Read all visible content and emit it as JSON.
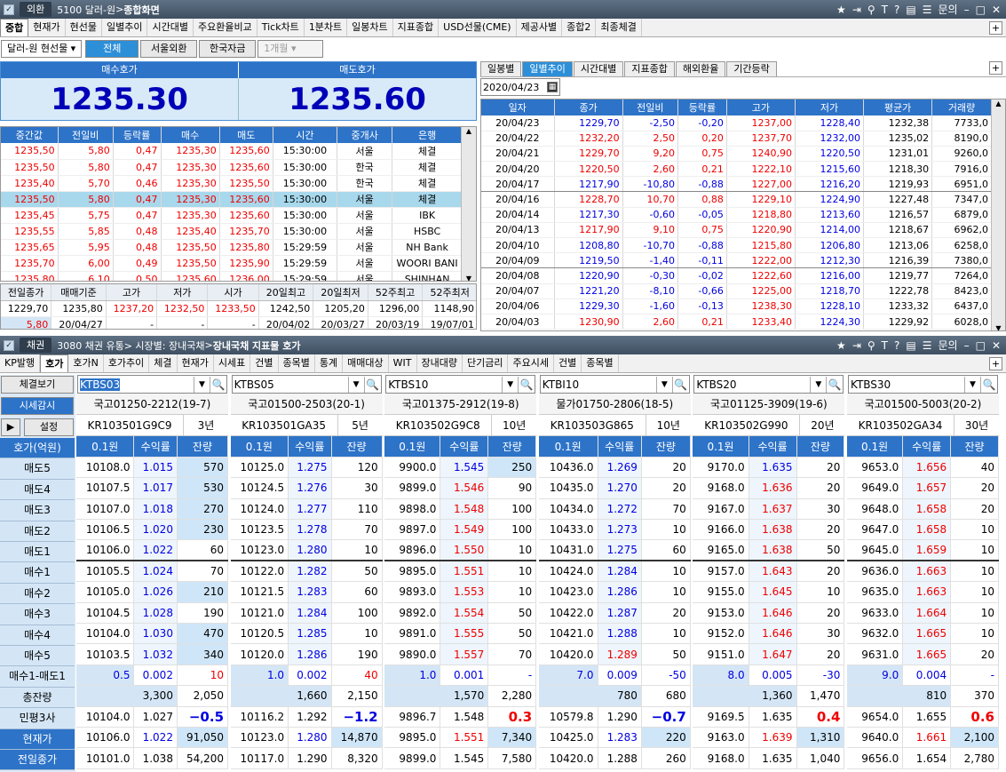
{
  "top_title": {
    "tag": "외환",
    "code": "5100 달러-원",
    "name": "종합화면",
    "right_label": "문의"
  },
  "top_menu": [
    "중합",
    "현재가",
    "현선물",
    "일별추이",
    "시간대별",
    "주요환율비교",
    "Tick차트",
    "1분차트",
    "일봉차트",
    "지표종합",
    "USD선물(CME)",
    "제공사별",
    "종합2",
    "최종체결"
  ],
  "top_menu_selected": 0,
  "filter": {
    "product": "달러-원 현선물",
    "tabs": [
      "전체",
      "서울외환",
      "한국자금"
    ],
    "period": "1개월"
  },
  "bid_label": "매수호가",
  "ask_label": "매도호가",
  "bid": "1235.30",
  "ask": "1235.60",
  "tick_headers": [
    "중간값",
    "전일비",
    "등락률",
    "매수",
    "매도",
    "시간",
    "중개사",
    "은행"
  ],
  "ticks": [
    [
      "1235,50",
      "5,80",
      "0,47",
      "1235,30",
      "1235,60",
      "15:30:00",
      "서울",
      "체결"
    ],
    [
      "1235,50",
      "5,80",
      "0,47",
      "1235,30",
      "1235,60",
      "15:30:00",
      "한국",
      "체결"
    ],
    [
      "1235,40",
      "5,70",
      "0,46",
      "1235,30",
      "1235,50",
      "15:30:00",
      "한국",
      "체결"
    ],
    [
      "1235,50",
      "5,80",
      "0,47",
      "1235,30",
      "1235,60",
      "15:30:00",
      "서울",
      "체결"
    ],
    [
      "1235,45",
      "5,75",
      "0,47",
      "1235,30",
      "1235,60",
      "15:30:00",
      "서울",
      "IBK"
    ],
    [
      "1235,55",
      "5,85",
      "0,48",
      "1235,40",
      "1235,70",
      "15:30:00",
      "서울",
      "HSBC"
    ],
    [
      "1235,65",
      "5,95",
      "0,48",
      "1235,50",
      "1235,80",
      "15:29:59",
      "서울",
      "NH Bank"
    ],
    [
      "1235,70",
      "6,00",
      "0,49",
      "1235,50",
      "1235,90",
      "15:29:59",
      "서울",
      "WOORI BANI"
    ],
    [
      "1235,80",
      "6,10",
      "0,50",
      "1235,60",
      "1236,00",
      "15:29:59",
      "서울",
      "SHINHAN"
    ]
  ],
  "tick_selected": 3,
  "summary_headers": [
    "전일종가",
    "매매기준",
    "고가",
    "저가",
    "시가",
    "20일최고",
    "20일최저",
    "52주최고",
    "52주최저"
  ],
  "summary_row1": [
    "1229,70",
    "1235,80",
    "1237,20",
    "1232,50",
    "1233,50",
    "1242,50",
    "1205,20",
    "1296,00",
    "1148,90"
  ],
  "summary_row2": [
    "5,80",
    "20/04/27",
    "-",
    "-",
    "-",
    "20/04/02",
    "20/03/27",
    "20/03/19",
    "19/07/01"
  ],
  "right_tabs": [
    "일봉별",
    "일별추이",
    "시간대별",
    "지표종합",
    "해외환율",
    "기간등락"
  ],
  "right_tab_selected": 1,
  "date_value": "2020/04/23",
  "daily_headers": [
    "일자",
    "종가",
    "전일비",
    "등락률",
    "고가",
    "저가",
    "평균가",
    "거래량"
  ],
  "daily": [
    [
      "20/04/23",
      "1229,70",
      "-2,50",
      "-0,20",
      "1237,00",
      "1228,40",
      "1232,38",
      "7733,0"
    ],
    [
      "20/04/22",
      "1232,20",
      "2,50",
      "0,20",
      "1237,70",
      "1232,00",
      "1235,02",
      "8190,0"
    ],
    [
      "20/04/21",
      "1229,70",
      "9,20",
      "0,75",
      "1240,90",
      "1220,50",
      "1231,01",
      "9260,0"
    ],
    [
      "20/04/20",
      "1220,50",
      "2,60",
      "0,21",
      "1222,10",
      "1215,60",
      "1218,30",
      "7916,0"
    ],
    [
      "20/04/17",
      "1217,90",
      "-10,80",
      "-0,88",
      "1227,00",
      "1216,20",
      "1219,93",
      "6951,0"
    ],
    [
      "20/04/16",
      "1228,70",
      "10,70",
      "0,88",
      "1229,10",
      "1224,90",
      "1227,48",
      "7347,0"
    ],
    [
      "20/04/14",
      "1217,30",
      "-0,60",
      "-0,05",
      "1218,80",
      "1213,60",
      "1216,57",
      "6879,0"
    ],
    [
      "20/04/13",
      "1217,90",
      "9,10",
      "0,75",
      "1220,90",
      "1214,00",
      "1218,67",
      "6962,0"
    ],
    [
      "20/04/10",
      "1208,80",
      "-10,70",
      "-0,88",
      "1215,80",
      "1206,80",
      "1213,06",
      "6258,0"
    ],
    [
      "20/04/09",
      "1219,50",
      "-1,40",
      "-0,11",
      "1222,00",
      "1212,30",
      "1216,39",
      "7380,0"
    ],
    [
      "20/04/08",
      "1220,90",
      "-0,30",
      "-0,02",
      "1222,60",
      "1216,00",
      "1219,77",
      "7264,0"
    ],
    [
      "20/04/07",
      "1221,20",
      "-8,10",
      "-0,66",
      "1225,00",
      "1218,70",
      "1222,78",
      "8423,0"
    ],
    [
      "20/04/06",
      "1229,30",
      "-1,60",
      "-0,13",
      "1238,30",
      "1228,10",
      "1233,32",
      "6437,0"
    ],
    [
      "20/04/03",
      "1230,90",
      "2,60",
      "0,21",
      "1233,40",
      "1224,30",
      "1229,92",
      "6028,0"
    ]
  ],
  "bot_title": {
    "tag": "채권",
    "code": "3080 채권 유통> 시장별: 장내국채",
    "name": "장내국채 지표물 호가",
    "right_label": "문의"
  },
  "bot_menu": [
    "KP발행",
    "호가",
    "호가N",
    "호가추이",
    "체결",
    "현재가",
    "시세표",
    "건별",
    "종목별",
    "통계",
    "매매대상",
    "WIT",
    "장내대량",
    "단기금리",
    "주요시세",
    "건별",
    "종목별"
  ],
  "bot_menu_selected": 1,
  "left_labels": {
    "btn1": "체결보기",
    "btn2": "시세감시",
    "btn3": "설정",
    "hdr": "호가(억원)",
    "rows": [
      "매도5",
      "매도4",
      "매도3",
      "매도2",
      "매도1",
      "매수1",
      "매수2",
      "매수3",
      "매수4",
      "매수5",
      "매수1-매도1",
      "총잔량",
      "민평3사",
      "현재가",
      "전일종가"
    ]
  },
  "bond_col_headers": [
    "0.1원",
    "수익률",
    "잔량"
  ],
  "bonds": [
    {
      "code": "KTBS03",
      "name": "국고01250-2212(19-7)",
      "isin": "KR103501G9C9",
      "term": "3년",
      "rows": [
        [
          "10108.0",
          "1.015",
          "570"
        ],
        [
          "10107.5",
          "1.017",
          "530"
        ],
        [
          "10107.0",
          "1.018",
          "270"
        ],
        [
          "10106.5",
          "1.020",
          "230"
        ],
        [
          "10106.0",
          "1.022",
          "60"
        ],
        [
          "10105.5",
          "1.024",
          "70"
        ],
        [
          "10105.0",
          "1.026",
          "210"
        ],
        [
          "10104.5",
          "1.028",
          "190"
        ],
        [
          "10104.0",
          "1.030",
          "470"
        ],
        [
          "10103.5",
          "1.032",
          "340"
        ]
      ],
      "diff": [
        "0.5",
        "0.002",
        "10"
      ],
      "total": [
        "3,300",
        "2,050"
      ],
      "minpyeong": [
        "10104.0",
        "1.027",
        "−0.5"
      ],
      "current": [
        "10106.0",
        "1.022",
        "91,050"
      ],
      "prev": [
        "10101.0",
        "1.038",
        "54,200"
      ]
    },
    {
      "code": "KTBS05",
      "name": "국고01500-2503(20-1)",
      "isin": "KR103501GA35",
      "term": "5년",
      "rows": [
        [
          "10125.0",
          "1.275",
          "120"
        ],
        [
          "10124.5",
          "1.276",
          "30"
        ],
        [
          "10124.0",
          "1.277",
          "110"
        ],
        [
          "10123.5",
          "1.278",
          "70"
        ],
        [
          "10123.0",
          "1.280",
          "10"
        ],
        [
          "10122.0",
          "1.282",
          "50"
        ],
        [
          "10121.5",
          "1.283",
          "60"
        ],
        [
          "10121.0",
          "1.284",
          "100"
        ],
        [
          "10120.5",
          "1.285",
          "10"
        ],
        [
          "10120.0",
          "1.286",
          "190"
        ]
      ],
      "diff": [
        "1.0",
        "0.002",
        "40"
      ],
      "total": [
        "1,660",
        "2,150"
      ],
      "minpyeong": [
        "10116.2",
        "1.292",
        "−1.2"
      ],
      "current": [
        "10123.0",
        "1.280",
        "14,870"
      ],
      "prev": [
        "10117.0",
        "1.290",
        "8,320"
      ]
    },
    {
      "code": "KTBS10",
      "name": "국고01375-2912(19-8)",
      "isin": "KR103502G9C8",
      "term": "10년",
      "rows": [
        [
          "9900.0",
          "1.545",
          "250"
        ],
        [
          "9899.0",
          "1.546",
          "90"
        ],
        [
          "9898.0",
          "1.548",
          "100"
        ],
        [
          "9897.0",
          "1.549",
          "100"
        ],
        [
          "9896.0",
          "1.550",
          "10"
        ],
        [
          "9895.0",
          "1.551",
          "10"
        ],
        [
          "9893.0",
          "1.553",
          "10"
        ],
        [
          "9892.0",
          "1.554",
          "50"
        ],
        [
          "9891.0",
          "1.555",
          "50"
        ],
        [
          "9890.0",
          "1.557",
          "70"
        ]
      ],
      "diff": [
        "1.0",
        "0.001",
        "-"
      ],
      "total": [
        "1,570",
        "2,280"
      ],
      "minpyeong": [
        "9896.7",
        "1.548",
        "0.3"
      ],
      "current": [
        "9895.0",
        "1.551",
        "7,340"
      ],
      "prev": [
        "9899.0",
        "1.545",
        "7,580"
      ]
    },
    {
      "code": "KTBI10",
      "name": "물가01750-2806(18-5)",
      "isin": "KR103503G865",
      "term": "10년",
      "rows": [
        [
          "10436.0",
          "1.269",
          "20"
        ],
        [
          "10435.0",
          "1.270",
          "20"
        ],
        [
          "10434.0",
          "1.272",
          "70"
        ],
        [
          "10433.0",
          "1.273",
          "10"
        ],
        [
          "10431.0",
          "1.275",
          "60"
        ],
        [
          "10424.0",
          "1.284",
          "10"
        ],
        [
          "10423.0",
          "1.286",
          "10"
        ],
        [
          "10422.0",
          "1.287",
          "20"
        ],
        [
          "10421.0",
          "1.288",
          "10"
        ],
        [
          "10420.0",
          "1.289",
          "50"
        ]
      ],
      "diff": [
        "7.0",
        "0.009",
        "-50"
      ],
      "total": [
        "780",
        "680"
      ],
      "minpyeong": [
        "10579.8",
        "1.290",
        "−0.7"
      ],
      "current": [
        "10425.0",
        "1.283",
        "220"
      ],
      "prev": [
        "10420.0",
        "1.288",
        "260"
      ]
    },
    {
      "code": "KTBS20",
      "name": "국고01125-3909(19-6)",
      "isin": "KR103502G990",
      "term": "20년",
      "rows": [
        [
          "9170.0",
          "1.635",
          "20"
        ],
        [
          "9168.0",
          "1.636",
          "20"
        ],
        [
          "9167.0",
          "1.637",
          "30"
        ],
        [
          "9166.0",
          "1.638",
          "20"
        ],
        [
          "9165.0",
          "1.638",
          "50"
        ],
        [
          "9157.0",
          "1.643",
          "20"
        ],
        [
          "9155.0",
          "1.645",
          "10"
        ],
        [
          "9153.0",
          "1.646",
          "20"
        ],
        [
          "9152.0",
          "1.646",
          "30"
        ],
        [
          "9151.0",
          "1.647",
          "20"
        ]
      ],
      "diff": [
        "8.0",
        "0.005",
        "-30"
      ],
      "total": [
        "1,360",
        "1,470"
      ],
      "minpyeong": [
        "9169.5",
        "1.635",
        "0.4"
      ],
      "current": [
        "9163.0",
        "1.639",
        "1,310"
      ],
      "prev": [
        "9168.0",
        "1.635",
        "1,040"
      ]
    },
    {
      "code": "KTBS30",
      "name": "국고01500-5003(20-2)",
      "isin": "KR103502GA34",
      "term": "30년",
      "rows": [
        [
          "9653.0",
          "1.656",
          "40"
        ],
        [
          "9649.0",
          "1.657",
          "20"
        ],
        [
          "9648.0",
          "1.658",
          "20"
        ],
        [
          "9647.0",
          "1.658",
          "10"
        ],
        [
          "9645.0",
          "1.659",
          "10"
        ],
        [
          "9636.0",
          "1.663",
          "10"
        ],
        [
          "9635.0",
          "1.663",
          "10"
        ],
        [
          "9633.0",
          "1.664",
          "10"
        ],
        [
          "9632.0",
          "1.665",
          "10"
        ],
        [
          "9631.0",
          "1.665",
          "20"
        ]
      ],
      "diff": [
        "9.0",
        "0.004",
        "-"
      ],
      "total": [
        "810",
        "370"
      ],
      "minpyeong": [
        "9654.0",
        "1.655",
        "0.6"
      ],
      "current": [
        "9640.0",
        "1.661",
        "2,100"
      ],
      "prev": [
        "9656.0",
        "1.654",
        "2,780"
      ]
    }
  ]
}
